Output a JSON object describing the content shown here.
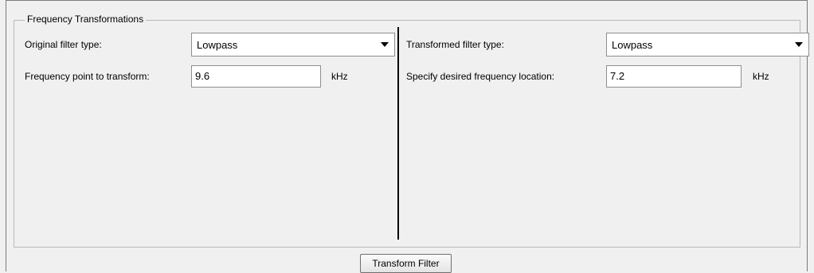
{
  "panel": {
    "title": "Frequency Transformations",
    "transform_button_label": "Transform Filter"
  },
  "left": {
    "filter_type_label": "Original filter type:",
    "filter_type_value": "Lowpass",
    "freq_label": "Frequency point to transform:",
    "freq_value": "9.6",
    "unit": "kHz"
  },
  "right": {
    "filter_type_label": "Transformed filter type:",
    "filter_type_value": "Lowpass",
    "freq_label": "Specify desired frequency location:",
    "freq_value": "7.2",
    "unit": "kHz"
  },
  "icons": {
    "dropdown": "chevron-down-icon"
  }
}
